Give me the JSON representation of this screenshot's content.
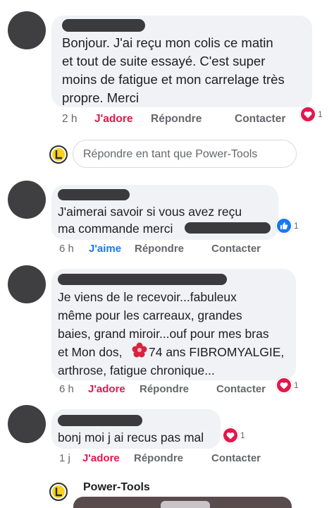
{
  "comments": [
    {
      "lines": [
        "Bonjour. J'ai  reçu mon colis ce matin",
        "et tout de suite essayé. C'est super",
        "moins de fatigue et mon carrelage très",
        "propre. Merci"
      ],
      "time": "2 h",
      "reaction_label": "J'adore",
      "reply": "Répondre",
      "contact": "Contacter",
      "reaction_count": "1",
      "reaction_icon": "love-icon"
    },
    {
      "lines": [
        "J'aimerai savoir si vous avez reçu",
        "ma commande merci"
      ],
      "time": "6 h",
      "reaction_label": "J'aime",
      "reply": "Répondre",
      "contact": "Contacter",
      "reaction_count": "1",
      "reaction_icon": "like-icon"
    },
    {
      "lines": [
        "Je viens de le recevoir...fabuleux",
        "même pour les carreaux, grandes",
        "baies, grand miroir...ouf pour mes bras",
        "et Mon dos,",
        "74 ans FIBROMYALGIE,",
        "arthrose, fatigue chronique..."
      ],
      "time": "6 h",
      "reaction_label": "J'adore",
      "reply": "Répondre",
      "contact": "Contacter",
      "reaction_count": "1",
      "reaction_icon": "love-icon"
    },
    {
      "lines": [
        "bonj moi j ai recus pas mal"
      ],
      "time": "1 j",
      "reaction_label": "J'adore",
      "reply": "Répondre",
      "contact": "Contacter",
      "reaction_count": "1",
      "reaction_icon": "love-icon"
    }
  ],
  "reply_box": {
    "placeholder": "Répondre en tant que Power-Tools"
  },
  "page_reply": {
    "name": "Power-Tools"
  },
  "colors": {
    "love": "#e4174d",
    "like": "#1877f2",
    "bubble": "#f0f2f5"
  }
}
